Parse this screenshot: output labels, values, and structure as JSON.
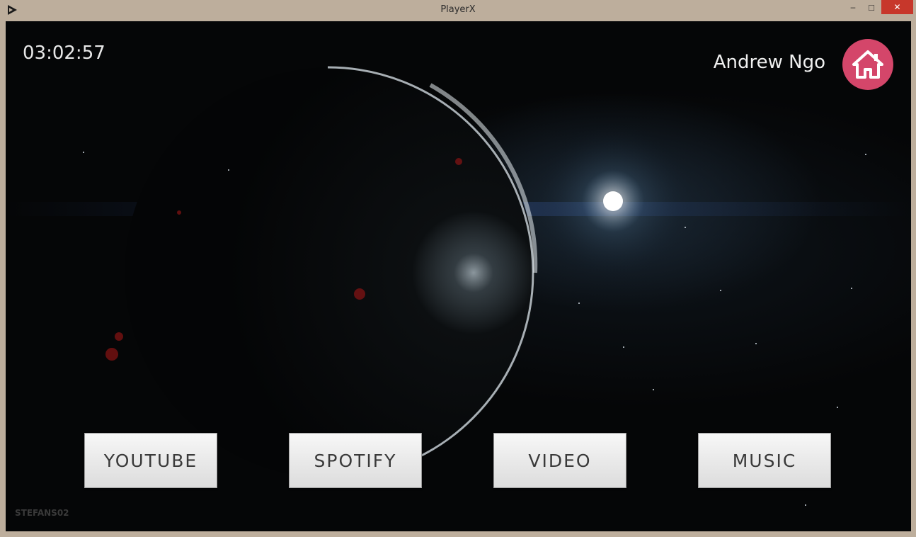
{
  "window": {
    "title": "PlayerX",
    "min_glyph": "–",
    "max_glyph": "□",
    "close_glyph": "✕"
  },
  "header": {
    "clock": "03:02:57",
    "user_name": "Andrew Ngo",
    "home_icon": "home-icon",
    "home_color": "#d4466a"
  },
  "nav": {
    "youtube": "YOUTUBE",
    "spotify": "SPOTIFY",
    "video": "VIDEO",
    "music": "MUSIC"
  },
  "background": {
    "watermark": "STEFANS02"
  }
}
